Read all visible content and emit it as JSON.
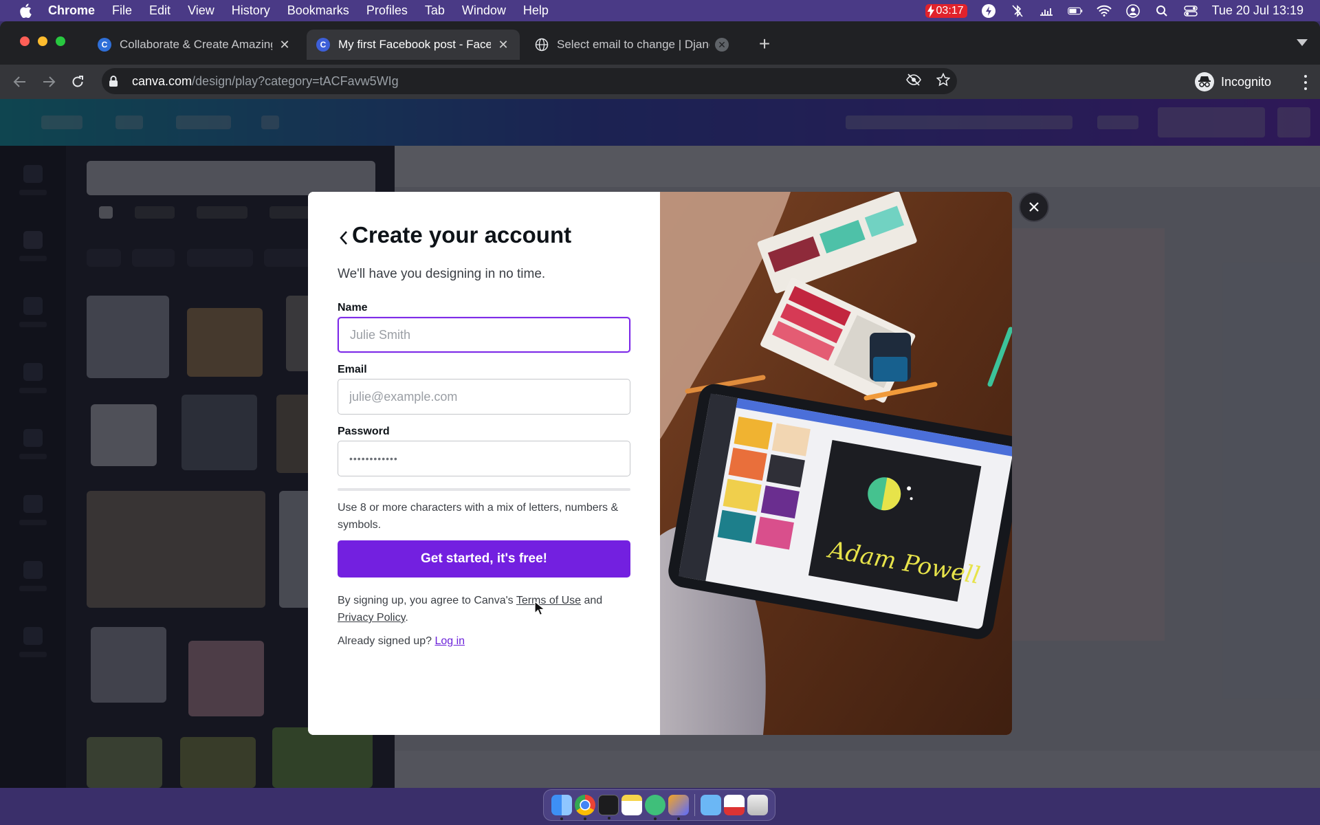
{
  "menubar": {
    "app_name": "Chrome",
    "items": [
      "File",
      "Edit",
      "View",
      "History",
      "Bookmarks",
      "Profiles",
      "Tab",
      "Window",
      "Help"
    ],
    "battery_time": "03:17",
    "datetime": "Tue 20 Jul  13:19"
  },
  "browser": {
    "tabs": [
      {
        "title": "Collaborate & Create Amazing",
        "favicon": "canva-favicon"
      },
      {
        "title": "My first Facebook post - Faceb",
        "favicon": "canva-favicon"
      },
      {
        "title": "Select email to change | Djang",
        "favicon": "globe-icon"
      }
    ],
    "active_tab_index": 1,
    "url_host": "canva.com",
    "url_path": "/design/play?category=tACFavw5WIg",
    "profile_label": "Incognito"
  },
  "signup_modal": {
    "heading": "Create your account",
    "subtitle": "We'll have you designing in no time.",
    "name_label": "Name",
    "name_placeholder": "Julie Smith",
    "email_label": "Email",
    "email_placeholder": "julie@example.com",
    "password_label": "Password",
    "password_value": "••••••••••••",
    "password_hint": "Use 8 or more characters with a mix of letters, numbers & symbols.",
    "cta_label": "Get started, it's free!",
    "terms_prefix": "By signing up, you agree to Canva's ",
    "terms_link": "Terms of Use",
    "terms_and": " and ",
    "privacy_link": "Privacy Policy",
    "terms_suffix": ".",
    "already_text": "Already signed up? ",
    "login_link": "Log in",
    "hero_signature": "Adam Powell"
  },
  "colors": {
    "accent": "#7320e0",
    "link": "#6b21d9",
    "focus_border": "#7d2ae8"
  }
}
